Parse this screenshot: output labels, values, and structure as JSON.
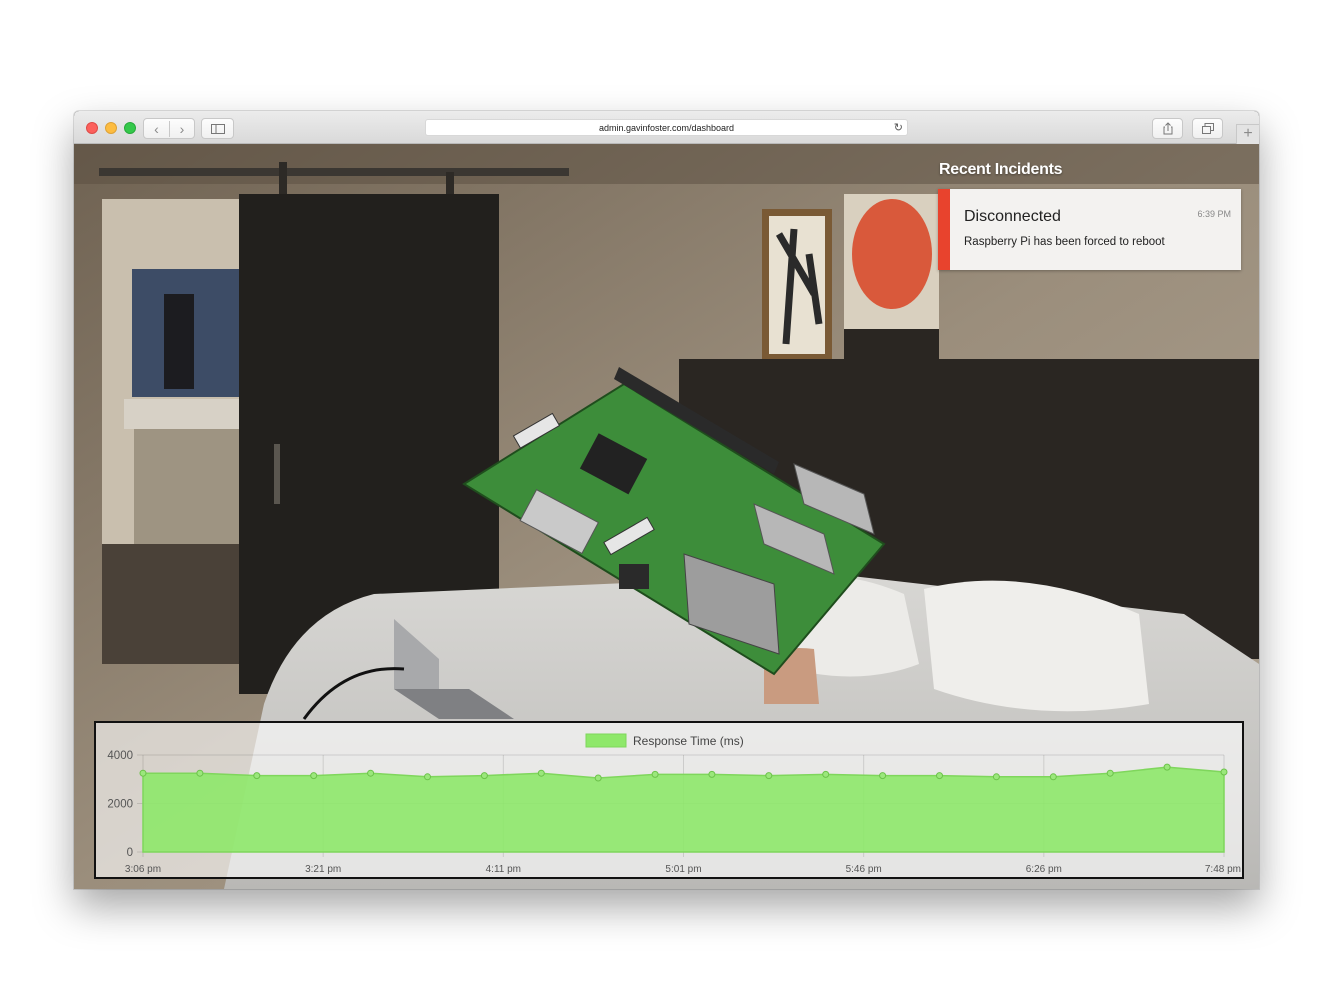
{
  "browser": {
    "url": "admin.gavinfoster.com/dashboard"
  },
  "incidents": {
    "heading": "Recent Incidents",
    "items": [
      {
        "title": "Disconnected",
        "time": "6:39 PM",
        "message": "Raspberry Pi has been forced to reboot",
        "status_color": "#e8432d"
      }
    ]
  },
  "colors": {
    "series_fill": "#8ee86a",
    "series_stroke": "#7fd65c",
    "incident_accent": "#e8432d"
  },
  "chart_data": {
    "type": "area",
    "legend": [
      "Response Time (ms)"
    ],
    "legend_position": "top",
    "x_tick_labels": [
      "3:06 pm",
      "3:21 pm",
      "4:11 pm",
      "5:01 pm",
      "5:46 pm",
      "6:26 pm",
      "7:48 pm"
    ],
    "y_tick_labels": [
      "4000",
      "2000",
      "0"
    ],
    "ylim": [
      0,
      4000
    ],
    "grid": true,
    "series": [
      {
        "name": "Response Time (ms)",
        "values": [
          3250,
          3250,
          3150,
          3150,
          3250,
          3100,
          3150,
          3250,
          3050,
          3200,
          3200,
          3150,
          3200,
          3150,
          3150,
          3100,
          3100,
          3250,
          3500,
          3300
        ]
      }
    ]
  }
}
